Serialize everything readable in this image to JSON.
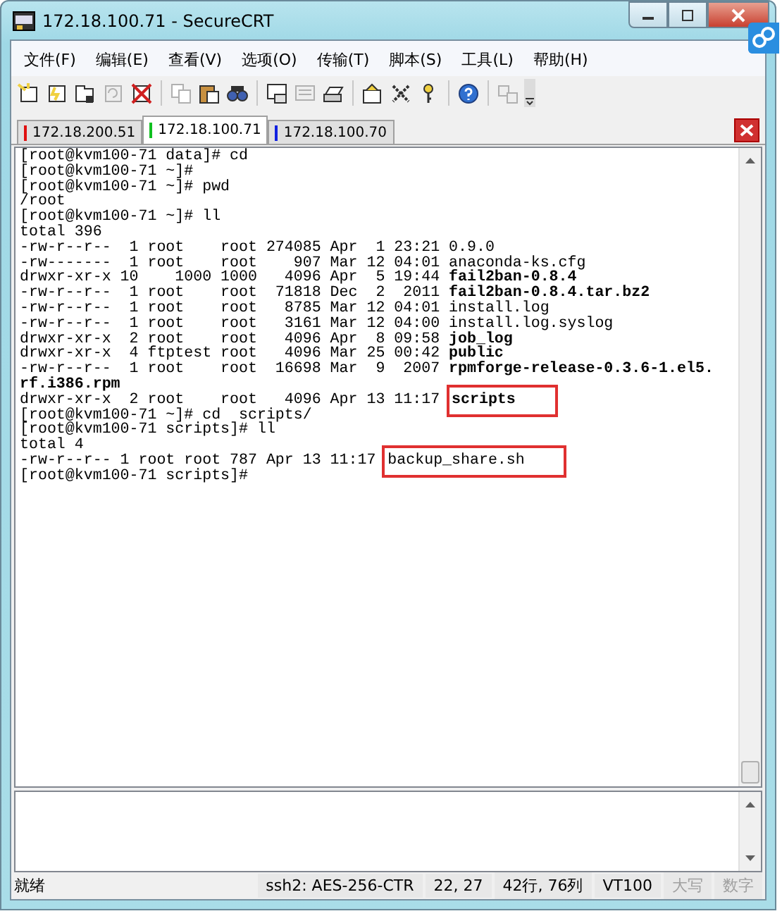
{
  "window": {
    "title": "172.18.100.71 - SecureCRT"
  },
  "menu": [
    "文件(F)",
    "编辑(E)",
    "查看(V)",
    "选项(O)",
    "传输(T)",
    "脚本(S)",
    "工具(L)",
    "帮助(H)"
  ],
  "toolbar": [
    {
      "kind": "connect",
      "disabled": false
    },
    {
      "kind": "quick-connect",
      "disabled": false
    },
    {
      "kind": "tab",
      "disabled": false
    },
    {
      "kind": "reconnect",
      "disabled": true
    },
    {
      "kind": "disconnect",
      "disabled": false
    },
    {
      "kind": "separator"
    },
    {
      "kind": "copy",
      "disabled": true
    },
    {
      "kind": "paste",
      "disabled": false
    },
    {
      "kind": "find",
      "disabled": false
    },
    {
      "kind": "separator"
    },
    {
      "kind": "monitor",
      "disabled": false
    },
    {
      "kind": "log",
      "disabled": true
    },
    {
      "kind": "print",
      "disabled": false
    },
    {
      "kind": "separator"
    },
    {
      "kind": "options",
      "disabled": false
    },
    {
      "kind": "keymap",
      "disabled": false
    },
    {
      "kind": "key",
      "disabled": false
    },
    {
      "kind": "separator"
    },
    {
      "kind": "help",
      "disabled": false
    },
    {
      "kind": "separator"
    },
    {
      "kind": "sftp",
      "disabled": true
    }
  ],
  "tabs": [
    {
      "label": "172.18.200.51",
      "color": "#e01010",
      "selected": false
    },
    {
      "label": "172.18.100.71",
      "color": "#10c020",
      "selected": true
    },
    {
      "label": "172.18.100.70",
      "color": "#1020e0",
      "selected": false
    }
  ],
  "terminal": {
    "lines": [
      {
        "text": "[root@kvm100-71 data]# cd"
      },
      {
        "text": "[root@kvm100-71 ~]#"
      },
      {
        "text": "[root@kvm100-71 ~]# pwd"
      },
      {
        "text": "/root"
      },
      {
        "text": "[root@kvm100-71 ~]# ll"
      },
      {
        "text": "total 396"
      },
      {
        "text": "-rw-r--r--  1 root    root 274085 Apr  1 23:21 ",
        "file": "0.9.0",
        "bold": false,
        "highlighted": false
      },
      {
        "text": "-rw-------  1 root    root    907 Mar 12 04:01 ",
        "file": "anaconda-ks.cfg",
        "bold": false,
        "highlighted": false
      },
      {
        "text": "drwxr-xr-x 10    1000 1000   4096 Apr  5 19:44 ",
        "file": "fail2ban-0.8.4",
        "bold": true,
        "highlighted": false
      },
      {
        "text": "-rw-r--r--  1 root    root  71818 Dec  2  2011 ",
        "file": "fail2ban-0.8.4.tar.bz2",
        "bold": true,
        "highlighted": false
      },
      {
        "text": "-rw-r--r--  1 root    root   8785 Mar 12 04:01 ",
        "file": "install.log",
        "bold": false,
        "highlighted": false
      },
      {
        "text": "-rw-r--r--  1 root    root   3161 Mar 12 04:00 ",
        "file": "install.log.syslog",
        "bold": false,
        "highlighted": false
      },
      {
        "text": "drwxr-xr-x  2 root    root   4096 Apr  8 09:58 ",
        "file": "job_log",
        "bold": true,
        "highlighted": false
      },
      {
        "text": "drwxr-xr-x  4 ftptest root   4096 Mar 25 00:42 ",
        "file": "public",
        "bold": true,
        "highlighted": false
      },
      {
        "text": "-rw-r--r--  1 root    root  16698 Mar  9  2007 ",
        "file": "rpmforge-release-0.3.6-1.el5.",
        "bold": true,
        "highlighted": false
      },
      {
        "file": "rf.i386.rpm",
        "bold": true,
        "highlighted": false
      },
      {
        "text": "drwxr-xr-x  2 root    root   4096 Apr 13 11:17 ",
        "file": "scripts",
        "bold": true,
        "highlighted": true
      },
      {
        "text": "[root@kvm100-71 ~]# cd  scripts/"
      },
      {
        "text": "[root@kvm100-71 scripts]# ll"
      },
      {
        "text": "total 4"
      },
      {
        "text": "-rw-r--r-- 1 root root 787 Apr 13 11:17 ",
        "file": "backup_share.sh",
        "bold": false,
        "highlighted": true
      },
      {
        "text": "[root@kvm100-71 scripts]#"
      }
    ]
  },
  "status_bar": [
    {
      "text": "ssh2: AES-256-CTR",
      "disabled": false
    },
    {
      "text": "22,  27",
      "disabled": false
    },
    {
      "text": "42行, 76列",
      "disabled": false
    },
    {
      "text": "VT100",
      "disabled": false
    },
    {
      "text": "大写",
      "disabled": true
    },
    {
      "text": "数字",
      "disabled": true
    }
  ],
  "status_text": "就绪"
}
